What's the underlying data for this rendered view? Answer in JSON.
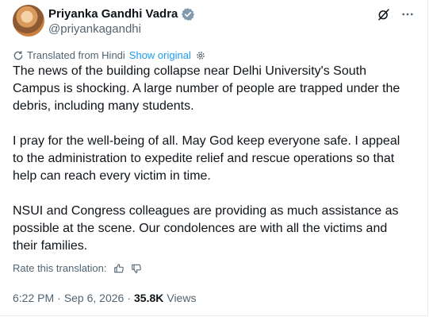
{
  "author": {
    "name": "Priyanka Gandhi Vadra",
    "handle": "@priyankagandhi"
  },
  "translation": {
    "label": "Translated from Hindi",
    "show_original": "Show original"
  },
  "post": {
    "paragraphs": [
      "The news of the building collapse near Delhi University's South Campus is shocking. A large number of people are trapped under the debris, including many students.",
      "I pray for the well-being of all. May God keep everyone safe. I appeal to the administration to expedite relief and rescue operations so that help can reach every victim in time.",
      "NSUI and Congress colleagues are providing as much assistance as possible at the scene. Our condolences are with all the victims and their families."
    ]
  },
  "rating": {
    "label": "Rate this translation:"
  },
  "meta": {
    "time": "6:22 PM",
    "separator": "·",
    "date": "Sep 6, 2026",
    "views_count": "35.8K",
    "views_label": "Views"
  },
  "colors": {
    "link": "#1d9bf0",
    "secondary_text": "#536471",
    "primary_text": "#0f1419",
    "verified_badge": "#829aab"
  }
}
